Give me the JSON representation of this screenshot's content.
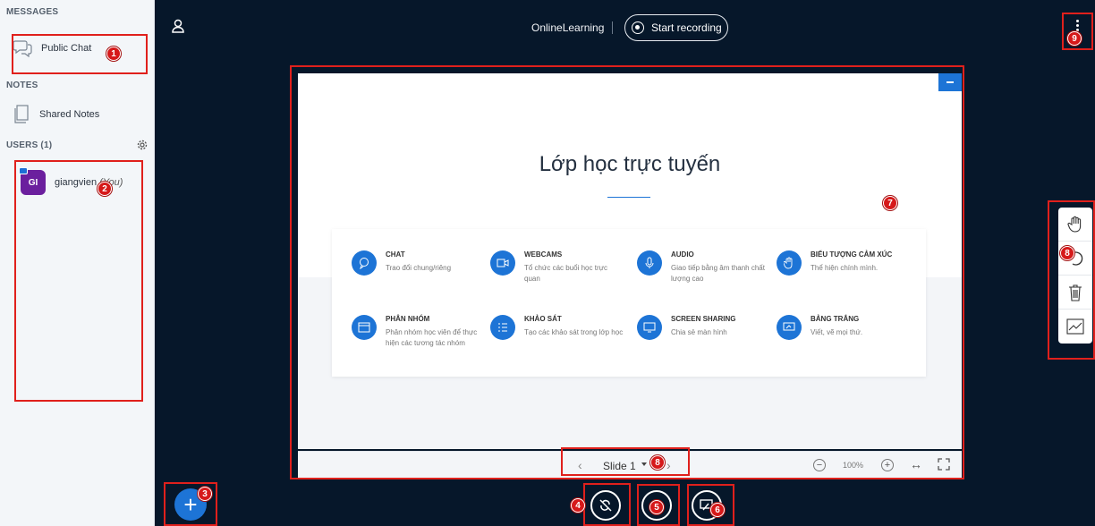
{
  "sidebar": {
    "messages_title": "MESSAGES",
    "public_chat": "Public Chat",
    "notes_title": "NOTES",
    "shared_notes": "Shared Notes",
    "users_title": "USERS (1)",
    "user": {
      "initials": "GI",
      "name": "giangvien",
      "you": "(You)"
    }
  },
  "topbar": {
    "title": "OnlineLearning",
    "record_label": "Start recording"
  },
  "slide": {
    "title": "Lớp học trực tuyến",
    "features": [
      {
        "name": "CHAT",
        "desc": "Trao đổi chung/riêng",
        "icon": "chat-icon"
      },
      {
        "name": "WEBCAMS",
        "desc": "Tổ chức các buổi học trực quan",
        "icon": "webcam-icon"
      },
      {
        "name": "AUDIO",
        "desc": "Giao tiếp bằng âm thanh chất lượng cao",
        "icon": "microphone-icon"
      },
      {
        "name": "BIỂU TƯỢNG CẢM XÚC",
        "desc": "Thể hiện chính mình.",
        "icon": "hand-icon"
      },
      {
        "name": "PHÂN NHÓM",
        "desc": "Phân nhóm học viên để thực hiện các tương tác nhóm",
        "icon": "breakout-icon"
      },
      {
        "name": "KHẢO SÁT",
        "desc": "Tạo các khảo sát trong lớp học",
        "icon": "poll-icon"
      },
      {
        "name": "SCREEN SHARING",
        "desc": "Chia sẻ màn hình",
        "icon": "screen-icon"
      },
      {
        "name": "BẢNG TRẮNG",
        "desc": "Viết, vẽ mọi thứ.",
        "icon": "whiteboard-icon"
      }
    ]
  },
  "controls": {
    "slide_label": "Slide 1",
    "zoom": "100%"
  },
  "badges": [
    "1",
    "2",
    "3",
    "4",
    "5",
    "6",
    "7",
    "8",
    "8",
    "9"
  ],
  "colors": {
    "accent": "#1d74d6",
    "background": "#06172a",
    "annotation": "#e0201c"
  }
}
